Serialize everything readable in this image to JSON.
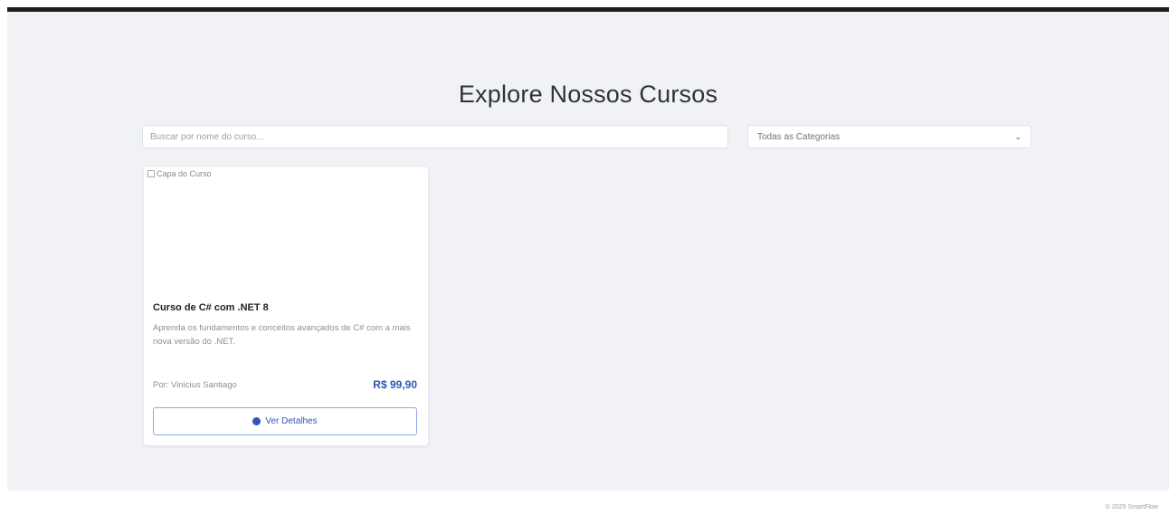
{
  "page": {
    "title": "Explore Nossos Cursos"
  },
  "search": {
    "placeholder": "Buscar por nome do curso..."
  },
  "category": {
    "selected": "Todas as Categorias",
    "chevron": "⌄"
  },
  "course": {
    "image_alt": "Capa do Curso",
    "title": "Curso de C# com .NET 8",
    "description": "Aprenda os fundamentos e conceitos avançados de C# com a mais nova versão do .NET.",
    "author": "Por: Vinicius Santiago",
    "price": "R$ 99,90",
    "button_label": "Ver Detalhes"
  },
  "footer": {
    "text": "© 2025 SmartFlow"
  },
  "colors": {
    "accent": "#2f56b8",
    "background": "#f1f2f6"
  },
  "icons": {
    "details_button": "eye-icon",
    "select": "chevron-down-icon",
    "image": "broken-image-icon"
  }
}
